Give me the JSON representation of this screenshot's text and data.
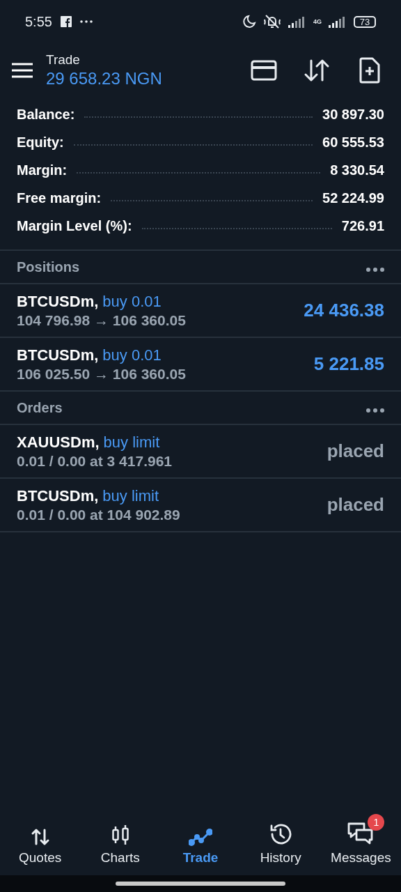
{
  "status_bar": {
    "time": "5:55",
    "network": "4G",
    "battery": "73"
  },
  "header": {
    "title": "Trade",
    "balance": "29 658.23 NGN"
  },
  "summary": [
    {
      "label": "Balance:",
      "value": "30 897.30"
    },
    {
      "label": "Equity:",
      "value": "60 555.53"
    },
    {
      "label": "Margin:",
      "value": "8 330.54"
    },
    {
      "label": "Free margin:",
      "value": "52 224.99"
    },
    {
      "label": "Margin Level (%):",
      "value": "726.91"
    }
  ],
  "sections": [
    {
      "title": "Positions",
      "kind": "positions",
      "rows": [
        {
          "symbol": "BTCUSDm,",
          "type": "buy 0.01",
          "detail": "104 796.98 → 106 360.05",
          "result": "24 436.38"
        },
        {
          "symbol": "BTCUSDm,",
          "type": "buy 0.01",
          "detail": "106 025.50 → 106 360.05",
          "result": "5 221.85"
        }
      ]
    },
    {
      "title": "Orders",
      "kind": "orders",
      "rows": [
        {
          "symbol": "XAUUSDm,",
          "type": "buy limit",
          "detail": "0.01 / 0.00 at 3 417.961",
          "result": "placed"
        },
        {
          "symbol": "BTCUSDm,",
          "type": "buy limit",
          "detail": "0.01 / 0.00 at 104 902.89",
          "result": "placed"
        }
      ]
    }
  ],
  "nav": [
    {
      "label": "Quotes",
      "kind": "quotes",
      "selected": false
    },
    {
      "label": "Charts",
      "kind": "charts",
      "selected": false
    },
    {
      "label": "Trade",
      "kind": "trade",
      "selected": true
    },
    {
      "label": "History",
      "kind": "history",
      "selected": false
    },
    {
      "label": "Messages",
      "kind": "messages",
      "selected": false,
      "badge": "1"
    }
  ]
}
